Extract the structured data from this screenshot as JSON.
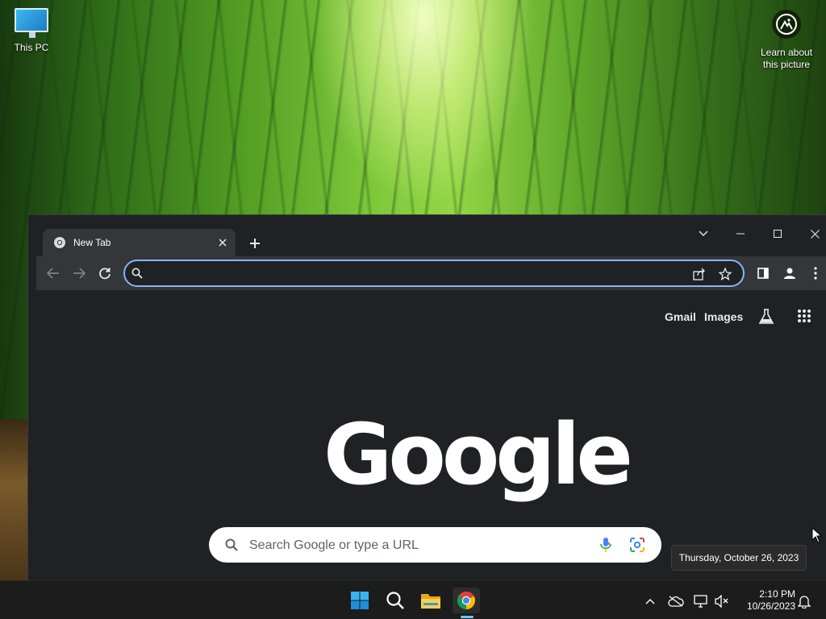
{
  "desktop": {
    "this_pc_label": "This PC",
    "learn_label": "Learn about this picture"
  },
  "browser": {
    "tab_title": "New Tab",
    "omnibox_value": "",
    "links": {
      "gmail": "Gmail",
      "images": "Images"
    },
    "logo": "Google",
    "search_placeholder": "Search Google or type a URL",
    "accent_color": "#8ab4f8"
  },
  "tooltip": {
    "text": "Thursday, October 26, 2023"
  },
  "taskbar": {
    "time": "2:10 PM",
    "date": "10/26/2023",
    "pinned": [
      "windows-start-icon",
      "search-icon",
      "file-explorer-icon",
      "chrome-icon"
    ],
    "active_indicator_color": "#60cdff"
  }
}
